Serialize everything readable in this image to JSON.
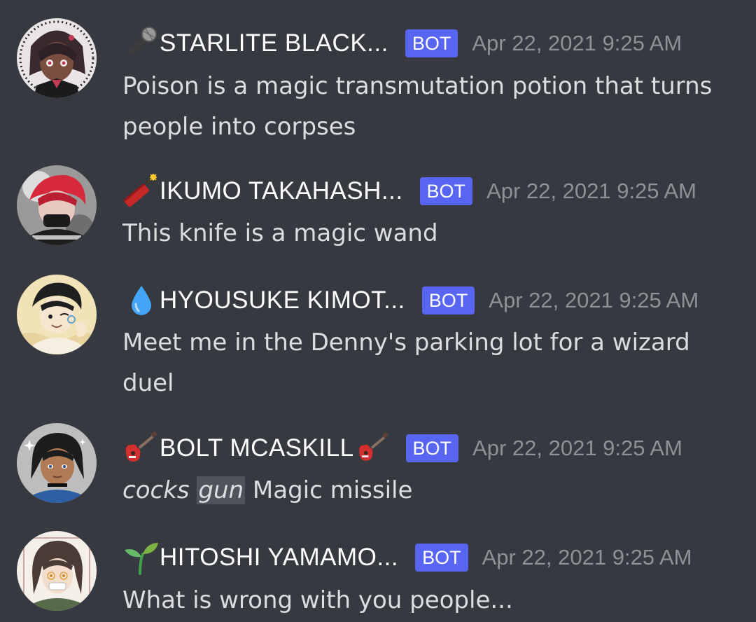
{
  "messages": [
    {
      "author": "STARLITE BLACK...",
      "bot_label": "BOT",
      "timestamp": "Apr 22, 2021 9:25 AM",
      "text": "Poison is a magic transmutation potion that turns people into corpses",
      "emoji": "microphone-icon",
      "avatar": "avatar-starlite"
    },
    {
      "author": "IKUMO TAKAHASH...",
      "bot_label": "BOT",
      "timestamp": "Apr 22, 2021 9:25 AM",
      "text": "This knife is a magic wand",
      "emoji": "firecracker-icon",
      "avatar": "avatar-ikumo"
    },
    {
      "author": "HYOUSUKE KIMOT...",
      "bot_label": "BOT",
      "timestamp": "Apr 22, 2021 9:25 AM",
      "text": "Meet me in the Denny's parking lot for a wizard duel",
      "emoji": "droplet-icon",
      "avatar": "avatar-hyousuke"
    },
    {
      "author": "BOLT MCASKILL",
      "bot_label": "BOT",
      "timestamp": "Apr 22, 2021 9:25 AM",
      "text_italic_1": "cocks ",
      "text_italic_2": "gun",
      "text_rest": " Magic missile",
      "emoji": "guitar-icon",
      "avatar": "avatar-bolt"
    },
    {
      "author": "HITOSHI YAMAMO...",
      "bot_label": "BOT",
      "timestamp": "Apr 22, 2021 9:25 AM",
      "text": "What is wrong with you people...",
      "emoji": "seedling-icon",
      "avatar": "avatar-hitoshi"
    }
  ],
  "colors": {
    "background": "#36393f",
    "bot_tag": "#5865f2",
    "username": "#ffffff",
    "timestamp": "#8e9297",
    "message_text": "#dcddde"
  }
}
